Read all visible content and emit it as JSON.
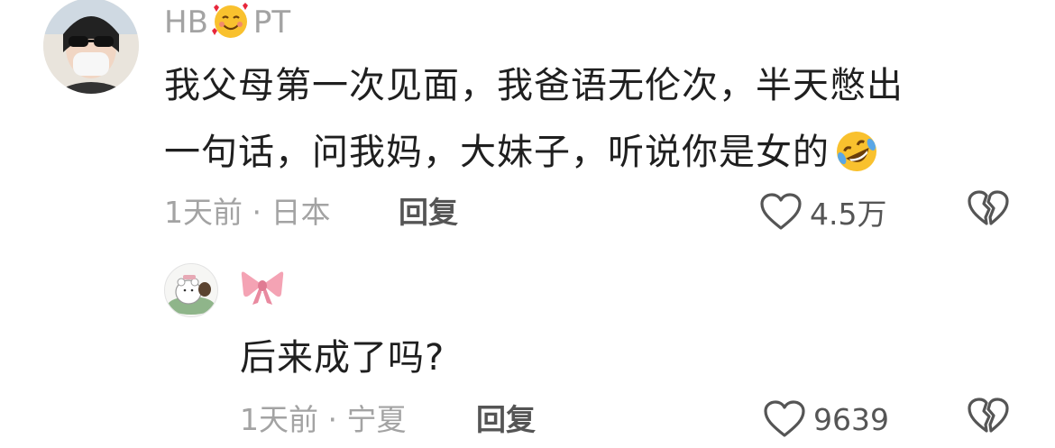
{
  "comments": [
    {
      "username_prefix": "HB",
      "username_suffix": "PT",
      "username_emoji": "smiling-face-with-hearts",
      "text_line1": "我父母第一次见面，我爸语无伦次，半天憋出",
      "text_line2": "一句话，问我妈，大妹子，听说你是女的",
      "text_emoji": "rolling-on-floor-laughing",
      "meta": "1天前 · 日本",
      "reply_label": "回复",
      "likes": "4.5万"
    },
    {
      "username_emoji": "ribbon-bow",
      "text": "后来成了吗?",
      "meta": "1天前 · 宁夏",
      "reply_label": "回复",
      "likes": "9639"
    }
  ],
  "colors": {
    "muted": "#a3a3a3",
    "text": "#1f1f1f",
    "icon": "#555555"
  }
}
